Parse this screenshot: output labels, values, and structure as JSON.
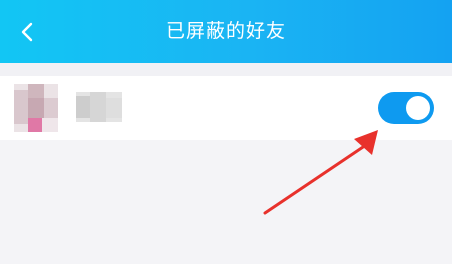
{
  "header": {
    "title": "已屏蔽的好友",
    "back_icon": "chevron-left-icon",
    "background_start": "#12c6f4",
    "background_end": "#14a2f2"
  },
  "blocked_list": [
    {
      "avatar": "blurred-avatar",
      "nickname": "",
      "toggle_on": true
    }
  ],
  "colors": {
    "toggle_on": "#0e9af0",
    "annotation_arrow": "#e8312c",
    "page_background": "#f4f4f7"
  }
}
